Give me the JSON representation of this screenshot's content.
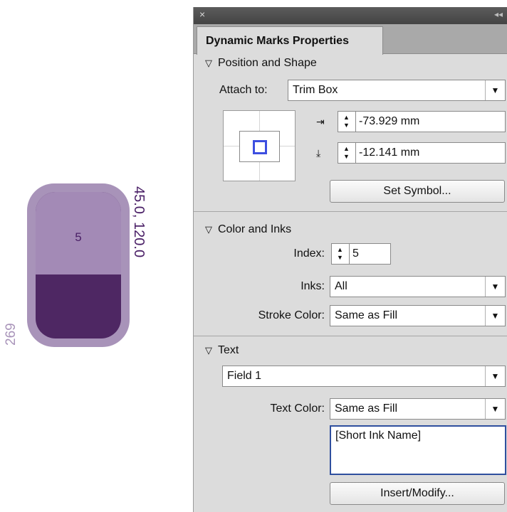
{
  "swatch": {
    "index_text": "5",
    "coords_text": "45.0, 120.0",
    "side_number": "269",
    "colors": {
      "outer": "#a893b9",
      "top": "#a38ab6",
      "bottom": "#4e2763"
    }
  },
  "panel": {
    "close_glyph": "×",
    "collapse_glyph": "◂◂",
    "tab_title": "Dynamic Marks Properties",
    "position_shape": {
      "heading": "Position and Shape",
      "attach_label": "Attach to:",
      "attach_value": "Trim Box",
      "x_value": "-73.929 mm",
      "y_value": "-12.141 mm",
      "set_symbol_label": "Set Symbol..."
    },
    "color_inks": {
      "heading": "Color and Inks",
      "index_label": "Index:",
      "index_value": "5",
      "inks_label": "Inks:",
      "inks_value": "All",
      "stroke_label": "Stroke Color:",
      "stroke_value": "Same as Fill"
    },
    "text": {
      "heading": "Text",
      "field_value": "Field 1",
      "text_color_label": "Text Color:",
      "text_color_value": "Same as Fill",
      "content": "[Short Ink Name]",
      "insert_label": "Insert/Modify..."
    }
  },
  "glyphs": {
    "disclosure": "▽",
    "dropdown_arrow": "▼",
    "step_up": "▲",
    "step_down": "▼",
    "x_offset_icon": "⇥",
    "y_offset_icon": "⤓"
  }
}
